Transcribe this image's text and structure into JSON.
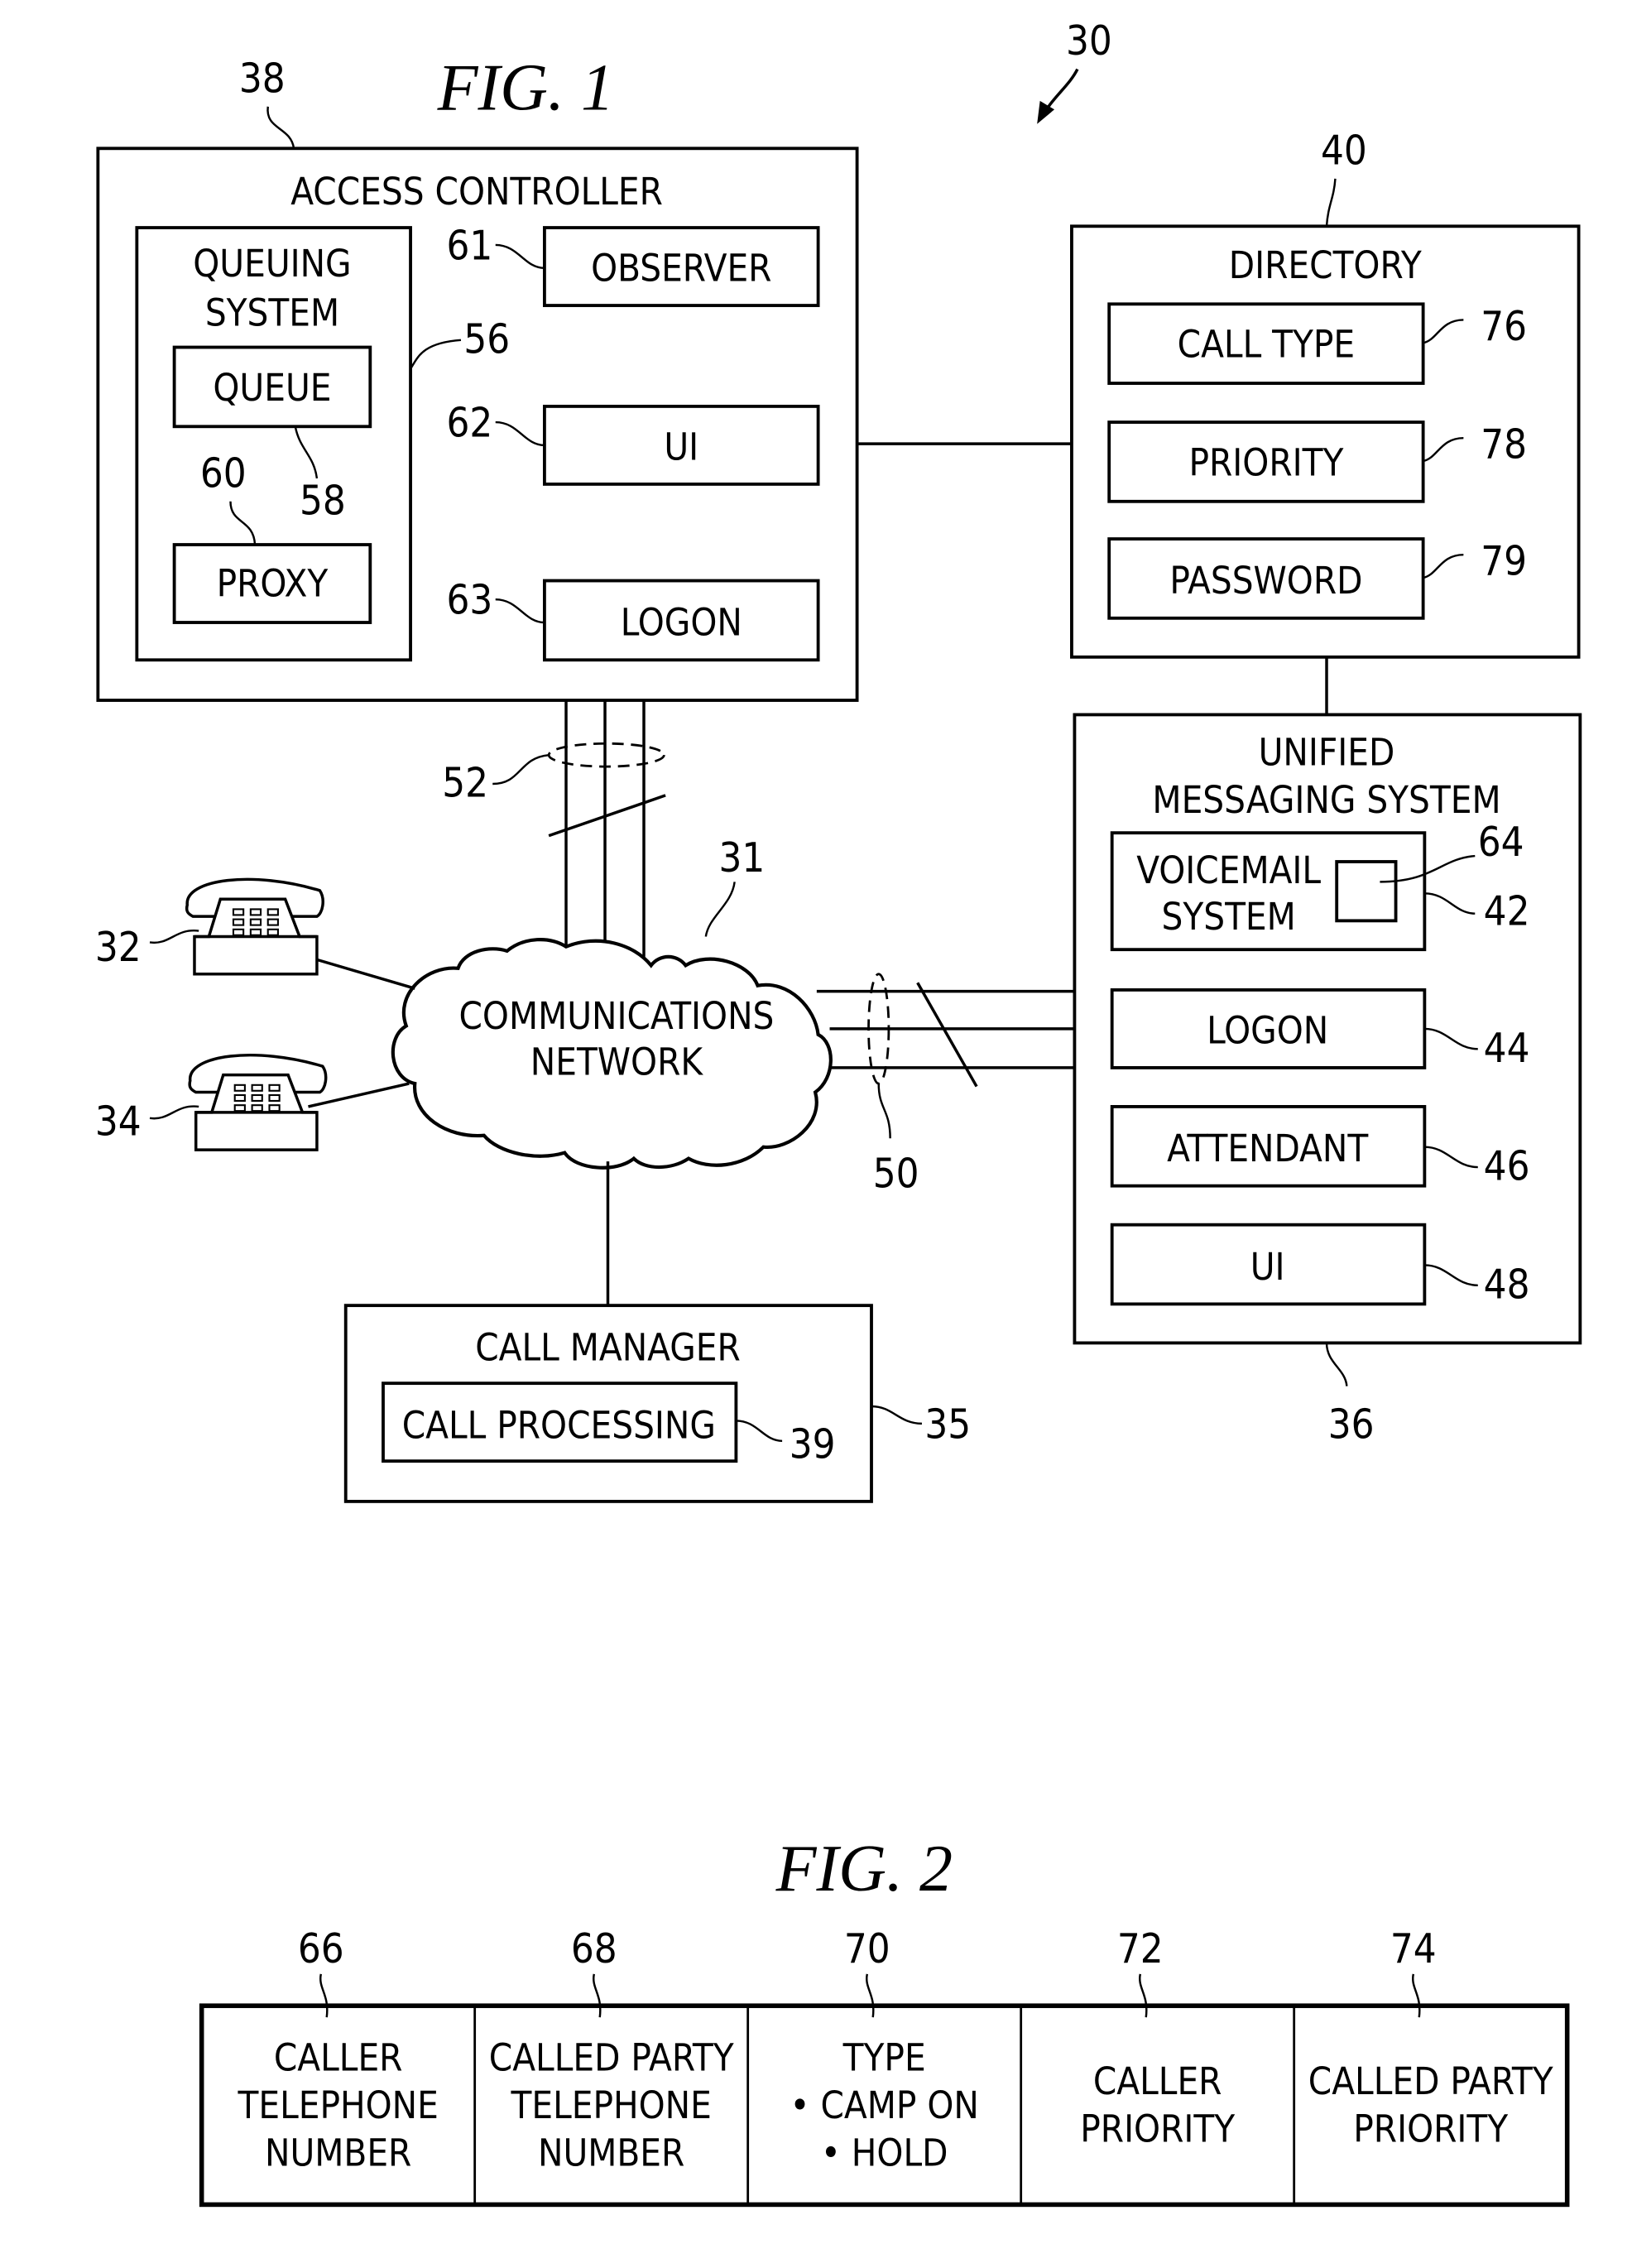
{
  "fig1": {
    "title": "FIG.  1",
    "system_ref": "30",
    "access_controller": {
      "ref": "38",
      "label": "ACCESS  CONTROLLER",
      "queuing_system": {
        "ref": "56",
        "label_line1": "QUEUING",
        "label_line2": "SYSTEM",
        "queue": {
          "ref": "58",
          "label": "QUEUE"
        },
        "proxy": {
          "ref": "60",
          "label": "PROXY"
        }
      },
      "observer": {
        "ref": "61",
        "label": "OBSERVER"
      },
      "ui": {
        "ref": "62",
        "label": "UI"
      },
      "logon": {
        "ref": "63",
        "label": "LOGON"
      }
    },
    "directory": {
      "ref": "40",
      "label": "DIRECTORY",
      "call_type": {
        "ref": "76",
        "label": "CALL  TYPE"
      },
      "priority": {
        "ref": "78",
        "label": "PRIORITY"
      },
      "password": {
        "ref": "79",
        "label": "PASSWORD"
      }
    },
    "unified_messaging": {
      "ref": "36",
      "label_line1": "UNIFIED",
      "label_line2": "MESSAGING  SYSTEM",
      "voicemail": {
        "ref": "42",
        "label_line1": "VOICEMAIL",
        "label_line2": "SYSTEM",
        "inner_ref": "64"
      },
      "logon": {
        "ref": "44",
        "label": "LOGON"
      },
      "attendant": {
        "ref": "46",
        "label": "ATTENDANT"
      },
      "ui": {
        "ref": "48",
        "label": "UI"
      }
    },
    "network": {
      "ref": "31",
      "label_line1": "COMMUNICATIONS",
      "label_line2": "NETWORK"
    },
    "bundle_top_ref": "52",
    "bundle_right_ref": "50",
    "phone1_ref": "32",
    "phone2_ref": "34",
    "call_manager": {
      "ref": "35",
      "label": "CALL  MANAGER",
      "call_processing": {
        "ref": "39",
        "label": "CALL  PROCESSING"
      }
    }
  },
  "fig2": {
    "title": "FIG.  2",
    "fields": [
      {
        "ref": "66",
        "lines": [
          "CALLER",
          "TELEPHONE",
          "NUMBER"
        ]
      },
      {
        "ref": "68",
        "lines": [
          "CALLED  PARTY",
          "TELEPHONE",
          "NUMBER"
        ]
      },
      {
        "ref": "70",
        "lines": [
          "TYPE",
          "• CAMP  ON",
          "• HOLD"
        ]
      },
      {
        "ref": "72",
        "lines": [
          "CALLER",
          "PRIORITY"
        ]
      },
      {
        "ref": "74",
        "lines": [
          "CALLED  PARTY",
          "PRIORITY"
        ]
      }
    ]
  }
}
